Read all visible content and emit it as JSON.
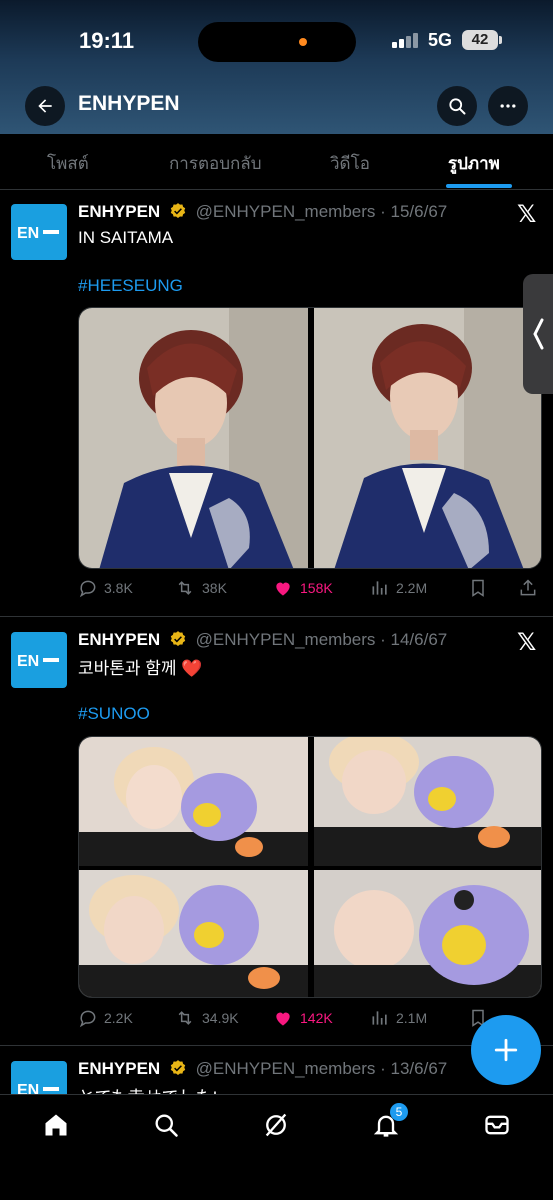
{
  "status_bar": {
    "time": "19:11",
    "network": "5G",
    "battery": "42"
  },
  "header": {
    "title": "ENHYPEN"
  },
  "tabs": [
    {
      "label": "โพสต์"
    },
    {
      "label": "การตอบกลับ"
    },
    {
      "label": "วิดีโอ"
    },
    {
      "label": "รูปภาพ"
    }
  ],
  "posts": [
    {
      "name": "ENHYPEN",
      "handle": "@ENHYPEN_members",
      "date": "· 15/6/67",
      "text": "IN SAITAMA",
      "hashtag": "#HEESEUNG",
      "stats": {
        "replies": "3.8K",
        "reposts": "38K",
        "likes": "158K",
        "views": "2.2M"
      }
    },
    {
      "name": "ENHYPEN",
      "handle": "@ENHYPEN_members",
      "date": "· 14/6/67",
      "text": "코바톤과 함께 ❤️",
      "hashtag": "#SUNOO",
      "stats": {
        "replies": "2.2K",
        "reposts": "34.9K",
        "likes": "142K",
        "views": "2.1M"
      }
    },
    {
      "name": "ENHYPEN",
      "handle": "@ENHYPEN_members",
      "date": "· 13/6/67",
      "text": "とても幸せでした!"
    }
  ],
  "bottom_nav": {
    "notifications_count": "5"
  },
  "colors": {
    "accent": "#1d9bf0",
    "like": "#f91880",
    "avatar_bg": "#1a9fe0"
  }
}
